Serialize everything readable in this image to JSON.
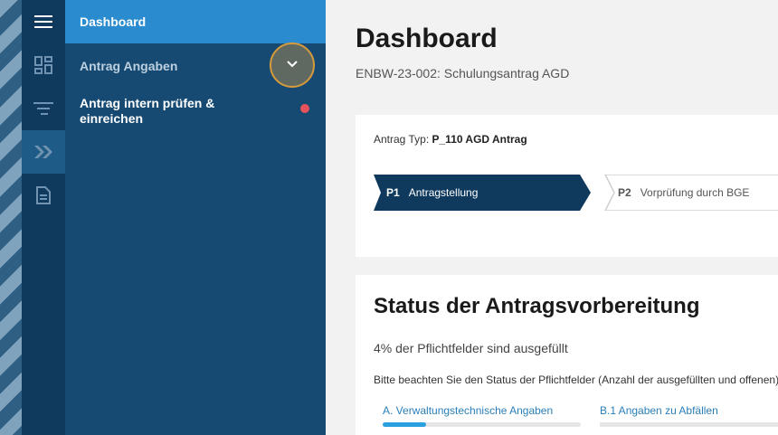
{
  "sidebar": {
    "dashboard": "Dashboard",
    "antrag_angaben": "Antrag Angaben",
    "antrag_pruefen": "Antrag intern prüfen & einreichen"
  },
  "page": {
    "title": "Dashboard",
    "subtitle": "ENBW-23-002: Schulungsantrag AGD"
  },
  "antrag": {
    "typ_label": "Antrag Typ:",
    "typ_value": "P_110 AGD Antrag",
    "steps": [
      {
        "code": "P1",
        "label": "Antragstellung",
        "active": true
      },
      {
        "code": "P2",
        "label": "Vorprüfung durch BGE",
        "active": false
      }
    ]
  },
  "status": {
    "title": "Status der Antragsvorbereitung",
    "percent_text": "4% der Pflichtfelder sind ausgefüllt",
    "hint": "Bitte beachten Sie den Status der Pflichtfelder (Anzahl der ausgefüllten und offenen)",
    "sections": [
      {
        "label": "A. Verwaltungstechnische Angaben",
        "progress": 0.22
      },
      {
        "label": "B.1 Angaben zu Abfällen",
        "progress": 0
      }
    ]
  },
  "colors": {
    "accent": "#2a8bcf",
    "sidebar": "#164a72",
    "rail": "#0f3a5e",
    "step_active": "#0f3a5e"
  }
}
